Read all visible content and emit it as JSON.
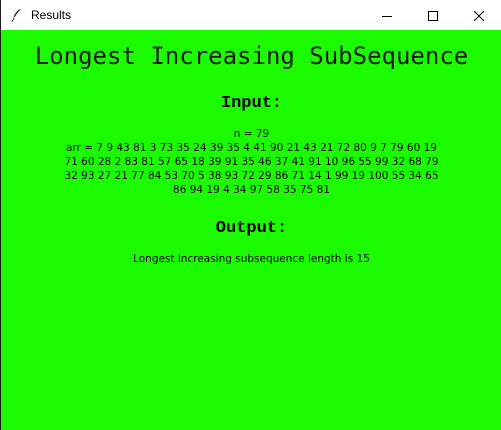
{
  "window": {
    "title": "Results",
    "icon": "feather-icon",
    "controls": [
      "minimize-icon",
      "maximize-icon",
      "close-icon"
    ],
    "background": "#1cfc00"
  },
  "main": {
    "title": "Longest Increasing SubSequence",
    "input_heading": "Input:",
    "n_line": "n = 79",
    "arr_lines": [
      "arr = 7 9 43 81 3 73 35 24 39 35 4 41 90 21 43 21 72 80 9 7 79 60 19",
      "71 60 28 2 83 81 57 65 18 39 91 35 46 37 41 91 10 96 55 99 32 68 79",
      "32 93 27 21 77 84 53 70 5 38 93 72 29 86 71 14 1 99 19 100 55 34 65",
      "86 94 19 4 34 97 58 35 75 81"
    ],
    "output_heading": "Output:",
    "result": "Longest increasing subsequence length is 15"
  }
}
